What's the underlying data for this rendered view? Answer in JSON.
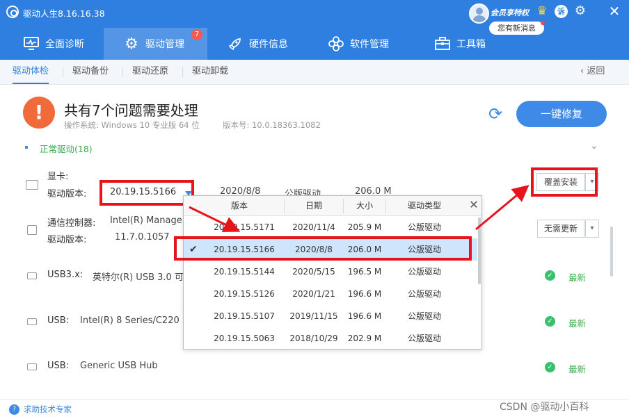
{
  "window": {
    "title": "驱动人生8.16.16.38"
  },
  "account": {
    "vip_text": "会员享特权",
    "message": "您有新消息",
    "sue_label": "诉"
  },
  "nav": {
    "items": [
      {
        "label": "全面诊断",
        "icon": "monitor-icon"
      },
      {
        "label": "驱动管理",
        "icon": "gear-icon",
        "badge": "7"
      },
      {
        "label": "硬件信息",
        "icon": "rocket-icon"
      },
      {
        "label": "软件管理",
        "icon": "flower-icon"
      },
      {
        "label": "工具箱",
        "icon": "toolbox-icon"
      }
    ]
  },
  "subtabs": {
    "items": [
      "驱动体检",
      "驱动备份",
      "驱动还原",
      "驱动卸载"
    ],
    "back": "返回"
  },
  "header": {
    "headline": "共有7个问题需要处理",
    "os": "操作系统: Windows 10 专业版 64 位",
    "version": "版本号: 10.0.18363.1082",
    "fix_button": "一键修复"
  },
  "section": {
    "label": "正常驱动(18)"
  },
  "devices": {
    "gpu": {
      "name_label": "显卡:",
      "version_label": "驱动版本:",
      "version_value": "20.19.15.5166",
      "date": "2020/8/8",
      "type": "公版驱动",
      "size": "206.0 M",
      "action": "覆盖安装"
    },
    "comm": {
      "name_label": "通信控制器:",
      "name_value": "Intel(R) Manage",
      "version_label": "驱动版本:",
      "version_value": "11.7.0.1057",
      "action": "无需更新"
    },
    "usb3": {
      "label": "USB3.x:",
      "value": "英特尔(R) USB 3.0 可",
      "status": "最新"
    },
    "usb_a": {
      "label": "USB:",
      "value": "Intel(R) 8 Series/C220",
      "status": "最新"
    },
    "usb_b": {
      "label": "USB:",
      "value": "Generic USB Hub",
      "status": "最新"
    }
  },
  "dropdown": {
    "headers": [
      "版本",
      "日期",
      "大小",
      "驱动类型"
    ],
    "rows": [
      {
        "version": "20.19.15.5171",
        "date": "2020/11/4",
        "size": "205.9 M",
        "type": "公版驱动",
        "selected": false
      },
      {
        "version": "20.19.15.5166",
        "date": "2020/8/8",
        "size": "206.0 M",
        "type": "公版驱动",
        "selected": true
      },
      {
        "version": "20.19.15.5144",
        "date": "2020/5/15",
        "size": "196.5 M",
        "type": "公版驱动",
        "selected": false
      },
      {
        "version": "20.19.15.5126",
        "date": "2020/1/21",
        "size": "196.6 M",
        "type": "公版驱动",
        "selected": false
      },
      {
        "version": "20.19.15.5107",
        "date": "2019/11/15",
        "size": "196.6 M",
        "type": "公版驱动",
        "selected": false
      },
      {
        "version": "20.19.15.5063",
        "date": "2018/10/29",
        "size": "202.9 M",
        "type": "公版驱动",
        "selected": false
      }
    ]
  },
  "footer": {
    "help": "求助技术专家",
    "watermark": "CSDN @驱动小百科"
  },
  "colors": {
    "primary": "#2f7fe0",
    "highlight": "#e8141b",
    "success": "#3bab4a",
    "warning": "#f06a3a"
  }
}
